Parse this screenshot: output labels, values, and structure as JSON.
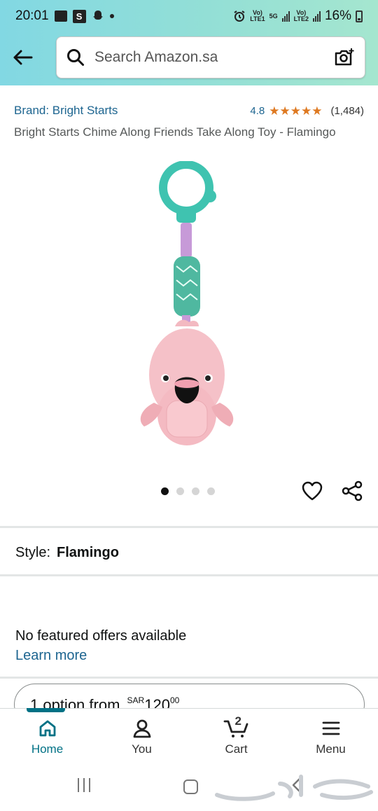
{
  "status_bar": {
    "time": "20:01",
    "network_1": "LTE1",
    "network_2": "LTE2",
    "network_5g": "5G",
    "volte": "Vo)",
    "battery": "16%"
  },
  "search": {
    "placeholder": "Search Amazon.sa",
    "value": ""
  },
  "product": {
    "brand": "Brand: Bright Starts",
    "rating": "4.8",
    "rating_count": "(1,484)",
    "stars": [
      "★",
      "★",
      "★",
      "★",
      "★"
    ],
    "title": "Bright Starts Chime Along Friends Take Along Toy - Flamingo",
    "image_icon": "flamingo-toy",
    "carousel_total": 4,
    "carousel_active": 1
  },
  "style": {
    "label": "Style:",
    "value": "Flamingo"
  },
  "offers": {
    "message": "No featured offers available",
    "link": "Learn more",
    "option_text": "1 option from",
    "currency": "SAR",
    "price_whole": "120",
    "price_fraction": "00"
  },
  "bottom_nav": {
    "items": [
      {
        "label": "Home",
        "icon": "home-icon",
        "active": true
      },
      {
        "label": "You",
        "icon": "user-icon",
        "active": false
      },
      {
        "label": "Cart",
        "icon": "cart-icon",
        "active": false
      },
      {
        "label": "Menu",
        "icon": "menu-icon",
        "active": false
      }
    ],
    "cart_count": "2"
  },
  "colors": {
    "link": "#1d6590",
    "star": "#de7921",
    "active_nav": "#007185",
    "header_start": "#82d8e3",
    "header_end": "#a5e6cf"
  }
}
